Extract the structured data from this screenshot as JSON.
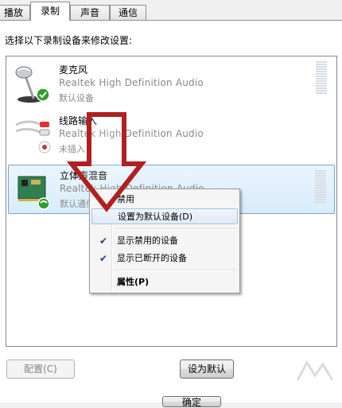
{
  "tabs": [
    {
      "label": "播放"
    },
    {
      "label": "录制",
      "active": true
    },
    {
      "label": "声音"
    },
    {
      "label": "通信"
    }
  ],
  "instruction": "选择以下录制设备来修改设置:",
  "devices": [
    {
      "name": "麦克风",
      "driver": "Realtek High Definition Audio",
      "status": "默认设备",
      "icon": "microphone-icon",
      "badge": "check"
    },
    {
      "name": "线路输入",
      "driver": "Realtek High Definition Audio",
      "status": "未插入",
      "icon": "line-in-cable-icon",
      "badge": "unplugged"
    },
    {
      "name": "立体声混音",
      "driver": "Realtek High Definition Audio",
      "status": "默认通信设备",
      "icon": "sound-card-icon",
      "badge": "phone",
      "selected": true
    }
  ],
  "context_menu": {
    "items": [
      {
        "label": "禁用",
        "checked": false
      },
      {
        "label": "设置为默认设备(D)",
        "checked": false,
        "hover": true
      },
      {
        "label": "显示禁用的设备",
        "checked": true
      },
      {
        "label": "显示已断开的设备",
        "checked": true
      },
      {
        "label": "属性(P)",
        "checked": false,
        "bold": true
      }
    ]
  },
  "buttons": {
    "configure": "配置(C)",
    "set_default": "设为默认",
    "ok": "确定"
  },
  "colors": {
    "arrow_stroke": "#b02020",
    "selection_border": "#7da2ce",
    "check_green": "#2f9e2f"
  }
}
